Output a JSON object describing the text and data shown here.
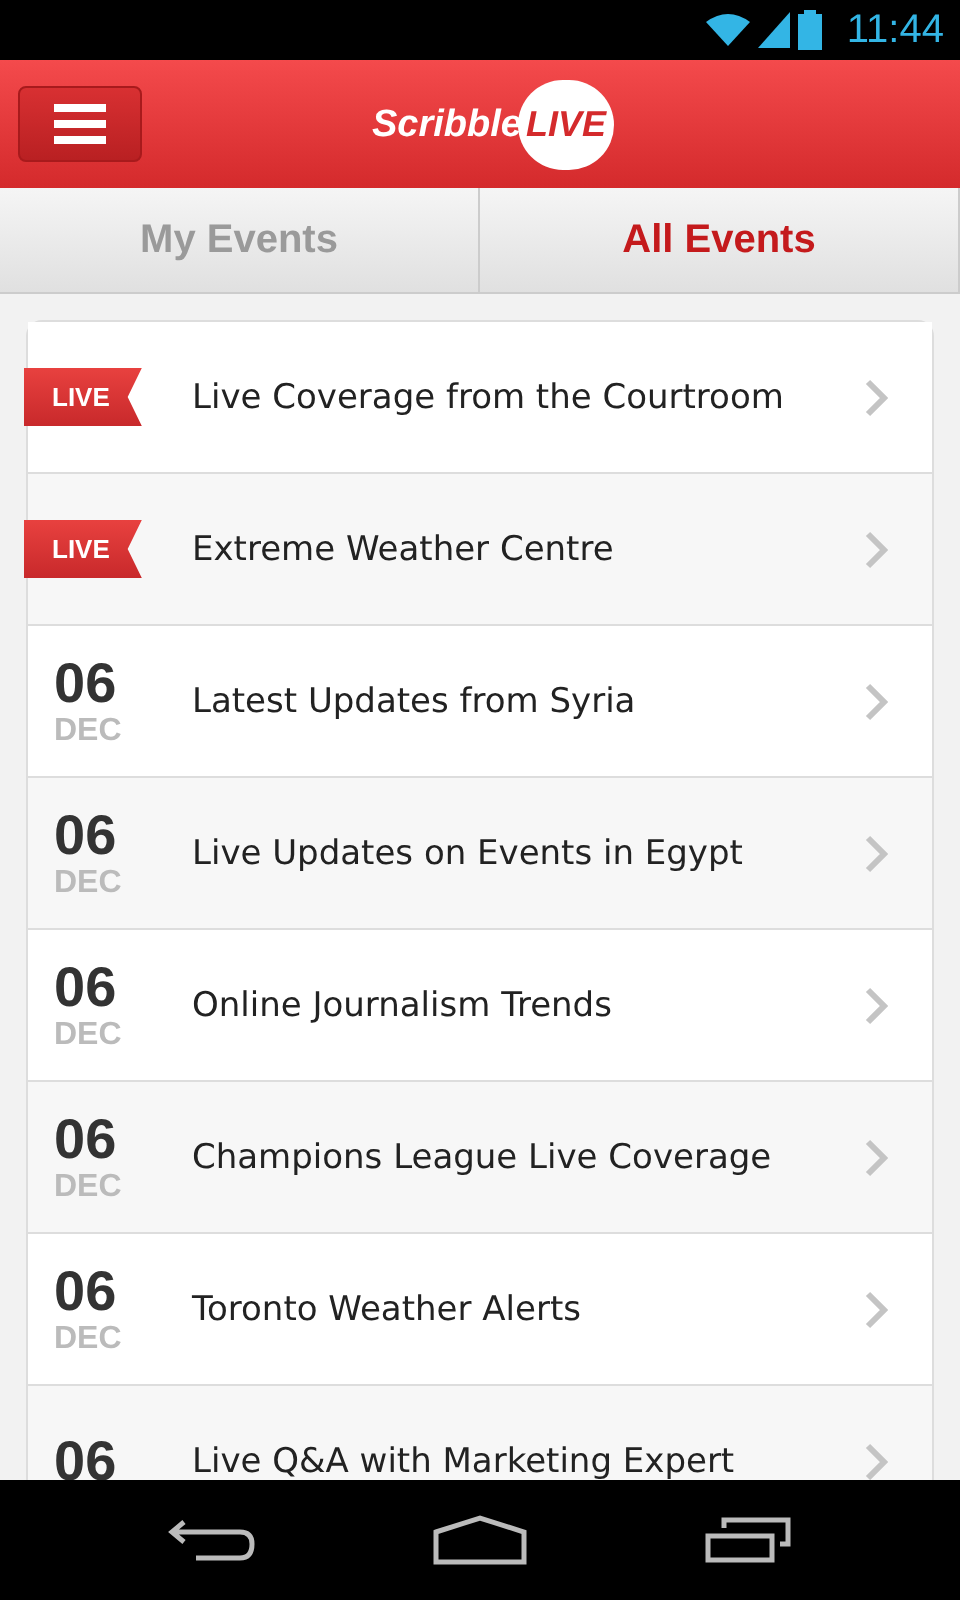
{
  "status_bar": {
    "time": "11:44"
  },
  "header": {
    "logo_word": "Scribble",
    "logo_badge": "LIVE"
  },
  "tabs": [
    {
      "label": "My Events",
      "selected": false
    },
    {
      "label": "All Events",
      "selected": true
    }
  ],
  "events": [
    {
      "kind": "live",
      "badge": "LIVE",
      "title": "Live Coverage from the Courtroom"
    },
    {
      "kind": "live",
      "badge": "LIVE",
      "title": "Extreme Weather Centre"
    },
    {
      "kind": "date",
      "day": "06",
      "month": "DEC",
      "title": "Latest Updates from Syria"
    },
    {
      "kind": "date",
      "day": "06",
      "month": "DEC",
      "title": "Live Updates on Events in Egypt"
    },
    {
      "kind": "date",
      "day": "06",
      "month": "DEC",
      "title": "Online Journalism Trends"
    },
    {
      "kind": "date",
      "day": "06",
      "month": "DEC",
      "title": "Champions League Live Coverage"
    },
    {
      "kind": "date",
      "day": "06",
      "month": "DEC",
      "title": "Toronto Weather Alerts"
    },
    {
      "kind": "date",
      "day": "06",
      "title": "Live Q&A with Marketing Expert"
    }
  ]
}
